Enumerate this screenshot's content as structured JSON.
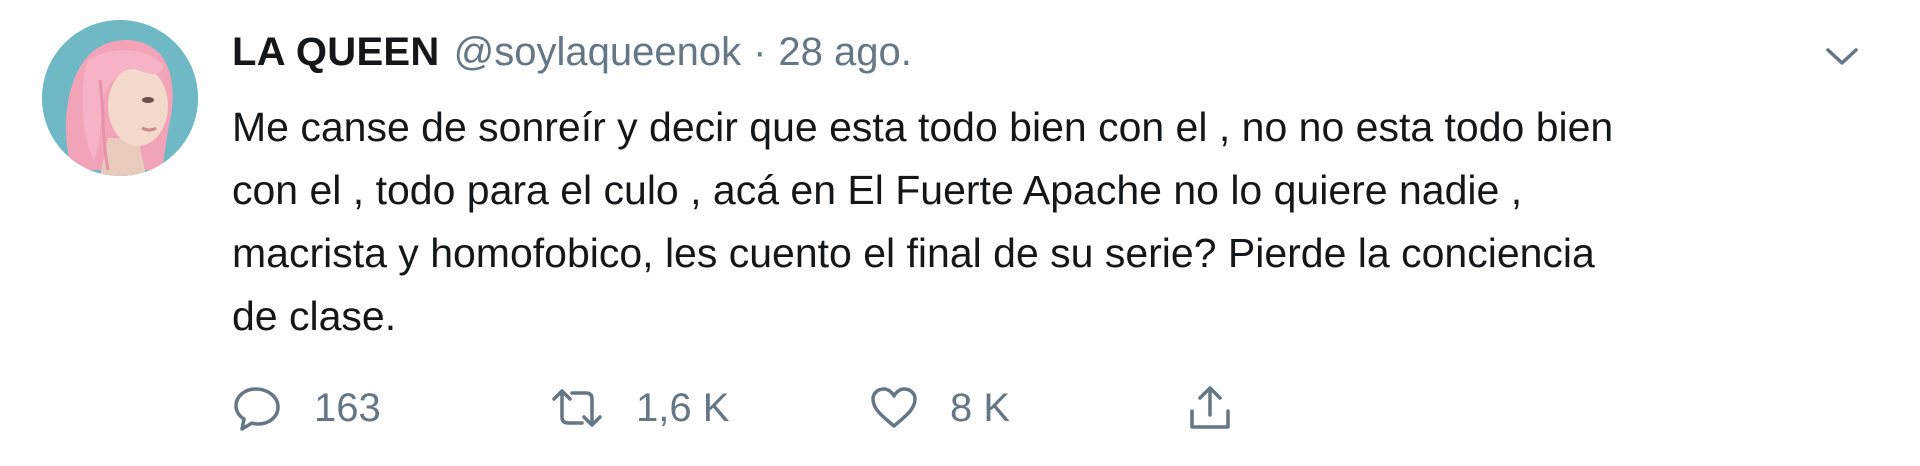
{
  "tweet": {
    "display_name": "LA QUEEN",
    "handle": "@soylaqueenok",
    "separator": "·",
    "date": "28 ago.",
    "text": "Me canse de sonreír y decir que esta todo bien con el , no no esta todo bien\ncon el , todo para el culo , acá en El Fuerte Apache no lo quiere nadie ,\nmacrista y homofobico, les cuento el final de su serie? Pierde la conciencia\nde clase."
  },
  "actions": {
    "reply": {
      "icon": "reply-icon",
      "count": "163"
    },
    "retweet": {
      "icon": "retweet-icon",
      "count": "1,6 K"
    },
    "like": {
      "icon": "heart-icon",
      "count": "8 K"
    },
    "share": {
      "icon": "share-icon"
    }
  },
  "colors": {
    "text_primary": "#14171a",
    "text_secondary": "#657786",
    "avatar_background": "#6fb9c6",
    "hair": "#f2a3b8"
  }
}
